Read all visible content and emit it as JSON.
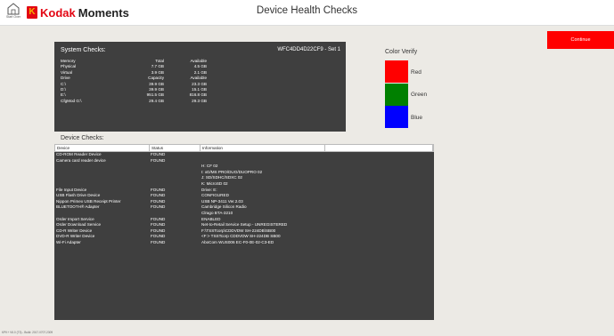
{
  "header": {
    "home_label": "Start Over",
    "brand_primary": "Kodak",
    "brand_secondary": "Moments",
    "title": "Device Health Checks"
  },
  "continue_label": "Continue",
  "system": {
    "title": "System Checks:",
    "machine_id": "WFC4DD4D22CF9 - Set 1",
    "rows": [
      [
        "Memory",
        "Total",
        "Available"
      ],
      [
        "Physical",
        "7.7 GB",
        "4.5 GB"
      ],
      [
        "Virtual",
        "3.9 GB",
        "2.1 GB"
      ],
      [
        "Drive",
        "Capacity",
        "Available"
      ],
      [
        "C:\\",
        "39.9 GB",
        "23.3 GB"
      ],
      [
        "D:\\",
        "39.9 GB",
        "15.1 GB"
      ],
      [
        "E:\\",
        "951.5 GB",
        "816.8 GB"
      ],
      [
        "CfgMod G:\\",
        "29.4 GB",
        "29.3 GB"
      ]
    ]
  },
  "color_verify": {
    "title": "Color Verify",
    "swatches": [
      {
        "label": "Red",
        "color": "#ff0000"
      },
      {
        "label": "Green",
        "color": "#008000"
      },
      {
        "label": "Blue",
        "color": "#0000ff"
      }
    ]
  },
  "devices": {
    "title": "Device Checks:",
    "columns": [
      "Device",
      "Status",
      "Information"
    ],
    "rows": [
      [
        "CD-ROM Reader Device",
        "FOUND",
        ""
      ],
      [
        "Camera card reader device",
        "FOUND",
        ""
      ],
      [
        "",
        "",
        "H: CF 02"
      ],
      [
        "",
        "",
        "I: xD/MS PRO/DUO/DUOPRO 02"
      ],
      [
        "",
        "",
        "J: SD/SDHC/SDXC 02"
      ],
      [
        "",
        "",
        "K: MicroSD 02"
      ],
      [
        "File Input Device",
        "FOUND",
        "Drive: E:"
      ],
      [
        "USB Flash Drive Device",
        "FOUND",
        "CONFIGURED"
      ],
      [
        "Nippon Primex USB Receipt Printer",
        "FOUND",
        "USB NP-3411 Ver.2.03"
      ],
      [
        "BLUETOOTH® Adapter",
        "FOUND",
        "Cambridge Silicon Radio"
      ],
      [
        "",
        "",
        "Clrago BTA-3210"
      ],
      [
        "Order Import Service",
        "FOUND",
        "ENABLED"
      ],
      [
        "Order Download Service",
        "FOUND",
        "Net-to-Retail Service Setup - UNREGISTERED"
      ],
      [
        "CD-R Writer Device",
        "FOUND",
        "F:\\TSSTcorp\\CDDVDW SH-224DB\\SB00"
      ],
      [
        "DVD-R Writer Device",
        "FOUND",
        "<F:> TSSTcorp CDDVDW SH-224DB SB00"
      ],
      [
        "Wi-Fi Adapter",
        "FOUND",
        "AboCom WUS006 EC-F0-0E-02-C3-ED"
      ]
    ]
  },
  "status_line": "KPK+ V6.0 (T3) - Build: 2017.0707.2309"
}
